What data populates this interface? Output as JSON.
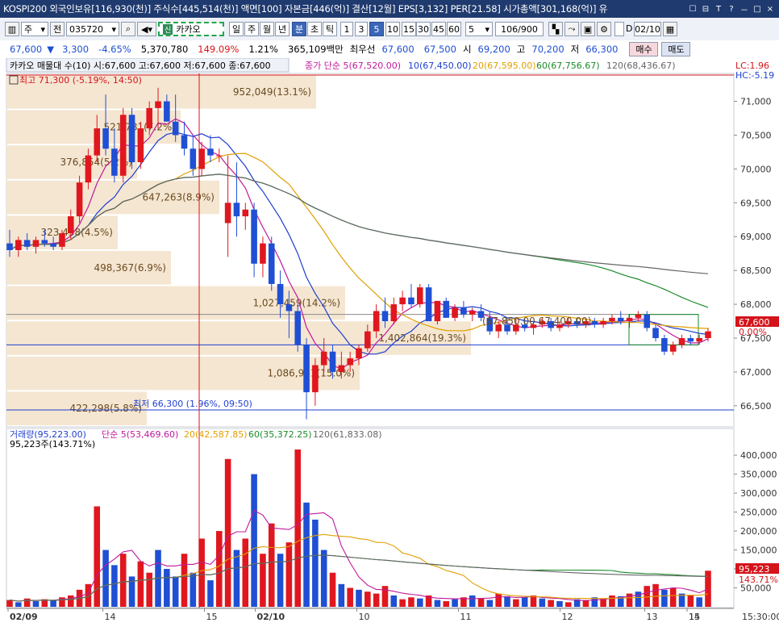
{
  "topbar": {
    "info": "KOSPI200 외국인보유[116,930(천)] 주식수[445,514(천)] 액면[100] 자본금[446(억)] 결산[12월] EPS[3,132] PER[21.58] 시가총액[301,168(억)] 유",
    "controls": [
      "☐",
      "⊟",
      "T",
      "?",
      "－",
      "□",
      "×"
    ]
  },
  "toolbar": {
    "period_type": "주",
    "sel_prefix": "전",
    "code": "035720",
    "stock_name": "카카오",
    "stock_badge": "신",
    "period_buttons": [
      "일",
      "주",
      "월",
      "년",
      "분",
      "초",
      "틱"
    ],
    "active_period": "분",
    "interval_buttons": [
      "1",
      "3",
      "5",
      "10",
      "15",
      "30",
      "45",
      "60"
    ],
    "active_interval": "5",
    "interval_select": "5",
    "count": "106/900",
    "date_check": "D",
    "date": "02/10",
    "buy_label": "매수",
    "sell_label": "매도"
  },
  "quote": {
    "price": "67,600",
    "change_arrow": "▼",
    "change": "3,300",
    "change_pct": "-4.65%",
    "volume": "5,370,780",
    "volume_ratio": "149.09%",
    "turnover_pct": "1.21%",
    "amount": "365,109백만",
    "best_ask_label": "최우선",
    "best_ask": "67,600",
    "best_bid": "67,500",
    "open_label": "시",
    "open": "69,200",
    "high_label": "고",
    "high": "70,200",
    "low_label": "저",
    "low": "66,300"
  },
  "price_panel": {
    "legend_main": "카카오 매물대 수(10)  시:67,600 고:67,600 저:67,600 종:67,600",
    "legend_ma": [
      {
        "text": "종가 단순 5(67,520.00)",
        "color": "#c0199b"
      },
      {
        "text": "10(67,450.00)",
        "color": "#1f3fd0"
      },
      {
        "text": "20(67,595.00)",
        "color": "#e0a000"
      },
      {
        "text": "60(67,756.67)",
        "color": "#1a8a2a"
      },
      {
        "text": "120(68,436.67)",
        "color": "#666666"
      }
    ],
    "lc": "LC:1.96",
    "hc": "HC:-5.19",
    "high_marker": "최고 71,300 (-5.19%, 14:50)",
    "low_marker": "최저 66,300 (1.96%, 09:50)",
    "current_price_tag": "67,600",
    "current_pct_tag": "0.00%",
    "y_ticks": [
      "71,000",
      "70,500",
      "70,000",
      "69,500",
      "69,000",
      "68,500",
      "68,000",
      "67,500",
      "67,000",
      "66,500"
    ],
    "volume_profile": [
      {
        "label": "952,049(13.1%)",
        "width": 0.64
      },
      {
        "label": "521,781(7.2%)",
        "width": 0.36
      },
      {
        "label": "376,854(5.2%)",
        "width": 0.27
      },
      {
        "label": "647,263(8.9%)",
        "width": 0.44
      },
      {
        "label": "323,438(4.5%)",
        "width": 0.23
      },
      {
        "label": "498,367(6.9%)",
        "width": 0.34
      },
      {
        "label": "1,027,459(14.2%)",
        "width": 0.7
      },
      {
        "label": "1,402,864(19.3%)",
        "width": 0.96
      },
      {
        "label": "1,086,951(15.0%)",
        "width": 0.73
      },
      {
        "label": "422,298(5.8%)",
        "width": 0.29
      }
    ],
    "box_annotation": "(67,850.00   67,400.00)"
  },
  "volume_panel": {
    "legend": [
      {
        "text": "거래량(95,223.00)",
        "color": "#1f3fd0"
      },
      {
        "text": "단순 5(53,469.60)",
        "color": "#c0199b"
      },
      {
        "text": "20(42,587.85)",
        "color": "#e0a000"
      },
      {
        "text": "60(35,372.25)",
        "color": "#1a8a2a"
      },
      {
        "text": "120(61,833.08)",
        "color": "#666666"
      }
    ],
    "sub": "95,223주(143.71%)",
    "y_ticks": [
      "400,000",
      "350,000",
      "300,000",
      "250,000",
      "200,000",
      "150,000",
      "100,000",
      "50,000"
    ],
    "current_tag": "95,223",
    "current_pct_tag": "143.71%"
  },
  "x_axis": {
    "labels": [
      "02/09",
      "14",
      "15",
      "02/10",
      "10",
      "11",
      "12",
      "13",
      "14",
      "15",
      "15:30:00"
    ]
  },
  "chart_data": {
    "type": "candlestick",
    "ylim": [
      66200,
      71400
    ],
    "volume_ylim": [
      0,
      430000
    ],
    "candles": [
      [
        68900,
        69100,
        68700,
        68800
      ],
      [
        68800,
        69000,
        68700,
        68950
      ],
      [
        68950,
        69050,
        68800,
        68850
      ],
      [
        68850,
        69000,
        68750,
        68950
      ],
      [
        68950,
        69100,
        68850,
        68900
      ],
      [
        68900,
        69000,
        68800,
        68850
      ],
      [
        68850,
        69100,
        68800,
        69050
      ],
      [
        69050,
        69400,
        68950,
        69300
      ],
      [
        69300,
        69900,
        69200,
        69800
      ],
      [
        69800,
        70300,
        69700,
        70200
      ],
      [
        70200,
        70800,
        70100,
        70600
      ],
      [
        70600,
        71100,
        70200,
        70300
      ],
      [
        70300,
        70600,
        69800,
        69900
      ],
      [
        69900,
        70900,
        69800,
        70800
      ],
      [
        70800,
        70900,
        70000,
        70100
      ],
      [
        70100,
        70700,
        70000,
        70600
      ],
      [
        70600,
        71000,
        70500,
        70900
      ],
      [
        70900,
        71200,
        70600,
        71000
      ],
      [
        71000,
        71100,
        70800,
        70700
      ],
      [
        70700,
        71100,
        70400,
        70500
      ],
      [
        70500,
        70700,
        70200,
        70300
      ],
      [
        70300,
        70500,
        69900,
        70000
      ],
      [
        70000,
        70400,
        69900,
        70300
      ],
      [
        70300,
        70500,
        70100,
        70200
      ],
      [
        70200,
        70300,
        70100,
        70200
      ],
      [
        69200,
        70200,
        68700,
        69500
      ],
      [
        69500,
        70100,
        69000,
        69300
      ],
      [
        69300,
        69500,
        69100,
        69400
      ],
      [
        69400,
        69500,
        68400,
        68600
      ],
      [
        68600,
        69000,
        68400,
        68900
      ],
      [
        68900,
        69000,
        68200,
        68300
      ],
      [
        68300,
        68500,
        67800,
        68000
      ],
      [
        68000,
        68200,
        67500,
        67900
      ],
      [
        67900,
        68000,
        67300,
        67400
      ],
      [
        67400,
        67500,
        66300,
        66700
      ],
      [
        66700,
        67200,
        66500,
        67100
      ],
      [
        67100,
        67500,
        67000,
        67300
      ],
      [
        67300,
        67400,
        66900,
        67000
      ],
      [
        67000,
        67300,
        66900,
        67100
      ],
      [
        67100,
        67300,
        67000,
        67200
      ],
      [
        67200,
        67400,
        67100,
        67350
      ],
      [
        67350,
        67700,
        67300,
        67600
      ],
      [
        67600,
        68000,
        67500,
        67900
      ],
      [
        67900,
        68100,
        67650,
        67750
      ],
      [
        67750,
        68100,
        67700,
        68000
      ],
      [
        68000,
        68200,
        67900,
        68100
      ],
      [
        68100,
        68300,
        67950,
        68000
      ],
      [
        68000,
        68300,
        67950,
        68250
      ],
      [
        68250,
        68300,
        67850,
        67750
      ],
      [
        67750,
        68050,
        67700,
        68050
      ],
      [
        68050,
        68100,
        67800,
        67800
      ],
      [
        67800,
        68000,
        67750,
        67950
      ],
      [
        67950,
        68050,
        67800,
        67850
      ],
      [
        67850,
        67950,
        67750,
        67900
      ],
      [
        67900,
        68000,
        67750,
        67800
      ],
      [
        67800,
        67900,
        67550,
        67600
      ],
      [
        67600,
        67750,
        67500,
        67700
      ],
      [
        67700,
        67800,
        67550,
        67600
      ],
      [
        67600,
        67800,
        67550,
        67700
      ],
      [
        67700,
        67800,
        67600,
        67650
      ],
      [
        67650,
        67750,
        67550,
        67700
      ],
      [
        67700,
        67800,
        67650,
        67750
      ],
      [
        67750,
        67800,
        67600,
        67650
      ],
      [
        67650,
        67750,
        67600,
        67700
      ],
      [
        67700,
        67800,
        67650,
        67750
      ],
      [
        67750,
        67800,
        67650,
        67700
      ],
      [
        67700,
        67800,
        67650,
        67750
      ],
      [
        67750,
        67800,
        67650,
        67700
      ],
      [
        67700,
        67800,
        67650,
        67750
      ],
      [
        67750,
        67850,
        67700,
        67800
      ],
      [
        67800,
        67900,
        67700,
        67750
      ],
      [
        67750,
        67850,
        67650,
        67800
      ],
      [
        67800,
        67900,
        67750,
        67850
      ],
      [
        67850,
        67900,
        67600,
        67650
      ],
      [
        67650,
        67700,
        67450,
        67500
      ],
      [
        67500,
        67550,
        67250,
        67300
      ],
      [
        67300,
        67450,
        67250,
        67400
      ],
      [
        67400,
        67550,
        67350,
        67500
      ],
      [
        67500,
        67550,
        67400,
        67450
      ],
      [
        67450,
        67550,
        67400,
        67500
      ],
      [
        67500,
        67650,
        67450,
        67600
      ]
    ],
    "volumes": [
      [
        18000,
        1
      ],
      [
        12000,
        0
      ],
      [
        22000,
        1
      ],
      [
        15000,
        0
      ],
      [
        20000,
        1
      ],
      [
        17000,
        0
      ],
      [
        25000,
        1
      ],
      [
        30000,
        1
      ],
      [
        45000,
        1
      ],
      [
        60000,
        1
      ],
      [
        265000,
        1
      ],
      [
        150000,
        0
      ],
      [
        110000,
        0
      ],
      [
        140000,
        1
      ],
      [
        80000,
        0
      ],
      [
        120000,
        1
      ],
      [
        90000,
        1
      ],
      [
        150000,
        0
      ],
      [
        100000,
        0
      ],
      [
        80000,
        0
      ],
      [
        140000,
        1
      ],
      [
        90000,
        0
      ],
      [
        180000,
        1
      ],
      [
        70000,
        0
      ],
      [
        200000,
        1
      ],
      [
        390000,
        1
      ],
      [
        150000,
        0
      ],
      [
        180000,
        1
      ],
      [
        350000,
        0
      ],
      [
        140000,
        1
      ],
      [
        220000,
        1
      ],
      [
        140000,
        0
      ],
      [
        170000,
        1
      ],
      [
        415000,
        1
      ],
      [
        275000,
        0
      ],
      [
        230000,
        0
      ],
      [
        150000,
        0
      ],
      [
        90000,
        1
      ],
      [
        60000,
        0
      ],
      [
        50000,
        1
      ],
      [
        45000,
        0
      ],
      [
        40000,
        1
      ],
      [
        35000,
        1
      ],
      [
        55000,
        1
      ],
      [
        30000,
        0
      ],
      [
        20000,
        1
      ],
      [
        25000,
        1
      ],
      [
        22000,
        0
      ],
      [
        30000,
        1
      ],
      [
        18000,
        0
      ],
      [
        15000,
        1
      ],
      [
        20000,
        0
      ],
      [
        25000,
        1
      ],
      [
        30000,
        0
      ],
      [
        22000,
        1
      ],
      [
        18000,
        0
      ],
      [
        35000,
        1
      ],
      [
        28000,
        0
      ],
      [
        20000,
        1
      ],
      [
        25000,
        0
      ],
      [
        30000,
        1
      ],
      [
        22000,
        0
      ],
      [
        18000,
        1
      ],
      [
        15000,
        0
      ],
      [
        12000,
        1
      ],
      [
        20000,
        0
      ],
      [
        18000,
        1
      ],
      [
        25000,
        0
      ],
      [
        22000,
        1
      ],
      [
        30000,
        1
      ],
      [
        28000,
        0
      ],
      [
        35000,
        1
      ],
      [
        40000,
        0
      ],
      [
        55000,
        1
      ],
      [
        60000,
        1
      ],
      [
        45000,
        0
      ],
      [
        50000,
        1
      ],
      [
        35000,
        0
      ],
      [
        30000,
        1
      ],
      [
        25000,
        0
      ],
      [
        95223,
        1
      ]
    ]
  }
}
